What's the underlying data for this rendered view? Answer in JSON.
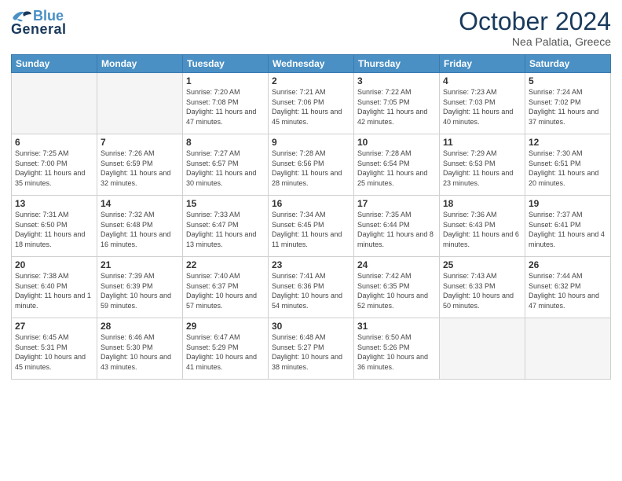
{
  "header": {
    "logo_general": "General",
    "logo_blue": "Blue",
    "month_title": "October 2024",
    "location": "Nea Palatia, Greece"
  },
  "weekdays": [
    "Sunday",
    "Monday",
    "Tuesday",
    "Wednesday",
    "Thursday",
    "Friday",
    "Saturday"
  ],
  "weeks": [
    [
      {
        "day": "",
        "sunrise": "",
        "sunset": "",
        "daylight": "",
        "empty": true
      },
      {
        "day": "",
        "sunrise": "",
        "sunset": "",
        "daylight": "",
        "empty": true
      },
      {
        "day": "1",
        "sunrise": "Sunrise: 7:20 AM",
        "sunset": "Sunset: 7:08 PM",
        "daylight": "Daylight: 11 hours and 47 minutes."
      },
      {
        "day": "2",
        "sunrise": "Sunrise: 7:21 AM",
        "sunset": "Sunset: 7:06 PM",
        "daylight": "Daylight: 11 hours and 45 minutes."
      },
      {
        "day": "3",
        "sunrise": "Sunrise: 7:22 AM",
        "sunset": "Sunset: 7:05 PM",
        "daylight": "Daylight: 11 hours and 42 minutes."
      },
      {
        "day": "4",
        "sunrise": "Sunrise: 7:23 AM",
        "sunset": "Sunset: 7:03 PM",
        "daylight": "Daylight: 11 hours and 40 minutes."
      },
      {
        "day": "5",
        "sunrise": "Sunrise: 7:24 AM",
        "sunset": "Sunset: 7:02 PM",
        "daylight": "Daylight: 11 hours and 37 minutes."
      }
    ],
    [
      {
        "day": "6",
        "sunrise": "Sunrise: 7:25 AM",
        "sunset": "Sunset: 7:00 PM",
        "daylight": "Daylight: 11 hours and 35 minutes."
      },
      {
        "day": "7",
        "sunrise": "Sunrise: 7:26 AM",
        "sunset": "Sunset: 6:59 PM",
        "daylight": "Daylight: 11 hours and 32 minutes."
      },
      {
        "day": "8",
        "sunrise": "Sunrise: 7:27 AM",
        "sunset": "Sunset: 6:57 PM",
        "daylight": "Daylight: 11 hours and 30 minutes."
      },
      {
        "day": "9",
        "sunrise": "Sunrise: 7:28 AM",
        "sunset": "Sunset: 6:56 PM",
        "daylight": "Daylight: 11 hours and 28 minutes."
      },
      {
        "day": "10",
        "sunrise": "Sunrise: 7:28 AM",
        "sunset": "Sunset: 6:54 PM",
        "daylight": "Daylight: 11 hours and 25 minutes."
      },
      {
        "day": "11",
        "sunrise": "Sunrise: 7:29 AM",
        "sunset": "Sunset: 6:53 PM",
        "daylight": "Daylight: 11 hours and 23 minutes."
      },
      {
        "day": "12",
        "sunrise": "Sunrise: 7:30 AM",
        "sunset": "Sunset: 6:51 PM",
        "daylight": "Daylight: 11 hours and 20 minutes."
      }
    ],
    [
      {
        "day": "13",
        "sunrise": "Sunrise: 7:31 AM",
        "sunset": "Sunset: 6:50 PM",
        "daylight": "Daylight: 11 hours and 18 minutes."
      },
      {
        "day": "14",
        "sunrise": "Sunrise: 7:32 AM",
        "sunset": "Sunset: 6:48 PM",
        "daylight": "Daylight: 11 hours and 16 minutes."
      },
      {
        "day": "15",
        "sunrise": "Sunrise: 7:33 AM",
        "sunset": "Sunset: 6:47 PM",
        "daylight": "Daylight: 11 hours and 13 minutes."
      },
      {
        "day": "16",
        "sunrise": "Sunrise: 7:34 AM",
        "sunset": "Sunset: 6:45 PM",
        "daylight": "Daylight: 11 hours and 11 minutes."
      },
      {
        "day": "17",
        "sunrise": "Sunrise: 7:35 AM",
        "sunset": "Sunset: 6:44 PM",
        "daylight": "Daylight: 11 hours and 8 minutes."
      },
      {
        "day": "18",
        "sunrise": "Sunrise: 7:36 AM",
        "sunset": "Sunset: 6:43 PM",
        "daylight": "Daylight: 11 hours and 6 minutes."
      },
      {
        "day": "19",
        "sunrise": "Sunrise: 7:37 AM",
        "sunset": "Sunset: 6:41 PM",
        "daylight": "Daylight: 11 hours and 4 minutes."
      }
    ],
    [
      {
        "day": "20",
        "sunrise": "Sunrise: 7:38 AM",
        "sunset": "Sunset: 6:40 PM",
        "daylight": "Daylight: 11 hours and 1 minute."
      },
      {
        "day": "21",
        "sunrise": "Sunrise: 7:39 AM",
        "sunset": "Sunset: 6:39 PM",
        "daylight": "Daylight: 10 hours and 59 minutes."
      },
      {
        "day": "22",
        "sunrise": "Sunrise: 7:40 AM",
        "sunset": "Sunset: 6:37 PM",
        "daylight": "Daylight: 10 hours and 57 minutes."
      },
      {
        "day": "23",
        "sunrise": "Sunrise: 7:41 AM",
        "sunset": "Sunset: 6:36 PM",
        "daylight": "Daylight: 10 hours and 54 minutes."
      },
      {
        "day": "24",
        "sunrise": "Sunrise: 7:42 AM",
        "sunset": "Sunset: 6:35 PM",
        "daylight": "Daylight: 10 hours and 52 minutes."
      },
      {
        "day": "25",
        "sunrise": "Sunrise: 7:43 AM",
        "sunset": "Sunset: 6:33 PM",
        "daylight": "Daylight: 10 hours and 50 minutes."
      },
      {
        "day": "26",
        "sunrise": "Sunrise: 7:44 AM",
        "sunset": "Sunset: 6:32 PM",
        "daylight": "Daylight: 10 hours and 47 minutes."
      }
    ],
    [
      {
        "day": "27",
        "sunrise": "Sunrise: 6:45 AM",
        "sunset": "Sunset: 5:31 PM",
        "daylight": "Daylight: 10 hours and 45 minutes."
      },
      {
        "day": "28",
        "sunrise": "Sunrise: 6:46 AM",
        "sunset": "Sunset: 5:30 PM",
        "daylight": "Daylight: 10 hours and 43 minutes."
      },
      {
        "day": "29",
        "sunrise": "Sunrise: 6:47 AM",
        "sunset": "Sunset: 5:29 PM",
        "daylight": "Daylight: 10 hours and 41 minutes."
      },
      {
        "day": "30",
        "sunrise": "Sunrise: 6:48 AM",
        "sunset": "Sunset: 5:27 PM",
        "daylight": "Daylight: 10 hours and 38 minutes."
      },
      {
        "day": "31",
        "sunrise": "Sunrise: 6:50 AM",
        "sunset": "Sunset: 5:26 PM",
        "daylight": "Daylight: 10 hours and 36 minutes."
      },
      {
        "day": "",
        "sunrise": "",
        "sunset": "",
        "daylight": "",
        "empty": true
      },
      {
        "day": "",
        "sunrise": "",
        "sunset": "",
        "daylight": "",
        "empty": true
      }
    ]
  ]
}
